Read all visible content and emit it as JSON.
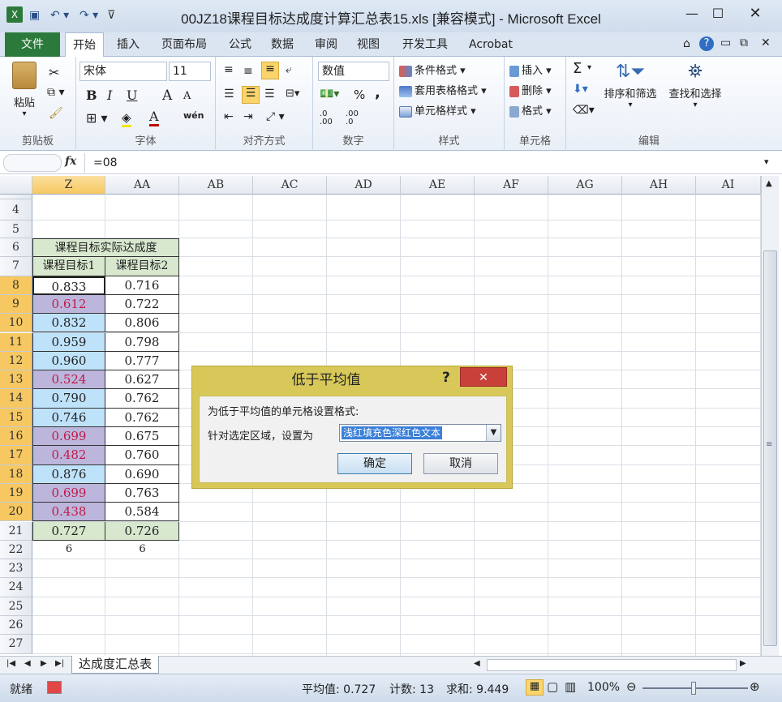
{
  "window": {
    "title": "00JZ18课程目标达成度计算汇总表15.xls  [兼容模式] - Microsoft Excel"
  },
  "tabs": [
    "文件",
    "开始",
    "插入",
    "页面布局",
    "公式",
    "数据",
    "审阅",
    "视图",
    "开发工具",
    "Acrobat"
  ],
  "ribbon": {
    "clipboard": {
      "paste": "粘贴",
      "label": "剪贴板"
    },
    "font": {
      "name": "宋体",
      "size": "11",
      "label": "字体",
      "bold": "B",
      "italic": "I",
      "underline": "U",
      "grow": "A",
      "shrink": "A",
      "fontcolor": "A",
      "wen": "wén"
    },
    "alignment": {
      "label": "对齐方式"
    },
    "number": {
      "format": "数值",
      "label": "数字",
      "percent": "%",
      "comma": ",",
      "inc": ".0 .00",
      "dec": ".00 .0"
    },
    "styles": {
      "cond": "条件格式",
      "table": "套用表格格式",
      "cell": "单元格样式",
      "label": "样式"
    },
    "cells": {
      "insert": "插入",
      "delete": "删除",
      "format": "格式",
      "label": "单元格"
    },
    "editing": {
      "sigma": "Σ",
      "sort": "排序和筛选",
      "find": "查找和选择",
      "label": "编辑"
    }
  },
  "formula": {
    "fx": "fx",
    "value": "=08"
  },
  "columns": [
    "Z",
    "AA",
    "AB",
    "AC",
    "AD",
    "AE",
    "AF",
    "AG",
    "AH",
    "AI"
  ],
  "rows": [
    "4",
    "5",
    "6",
    "7",
    "8",
    "9",
    "10",
    "11",
    "12",
    "13",
    "14",
    "15",
    "16",
    "17",
    "18",
    "19",
    "20",
    "21",
    "22",
    "23",
    "24",
    "25",
    "26",
    "27"
  ],
  "table": {
    "title": "课程目标实际达成度",
    "headers": [
      "课程目标1",
      "课程目标2"
    ],
    "col1": [
      "0.833",
      "0.612",
      "0.832",
      "0.959",
      "0.960",
      "0.524",
      "0.790",
      "0.746",
      "0.699",
      "0.482",
      "0.876",
      "0.699",
      "0.438"
    ],
    "col1_style": [
      "plain",
      "purple",
      "blue",
      "blue",
      "blue",
      "purple",
      "blue",
      "blue",
      "purple",
      "purple",
      "blue",
      "purple",
      "purple"
    ],
    "col2": [
      "0.716",
      "0.722",
      "0.806",
      "0.798",
      "0.777",
      "0.627",
      "0.762",
      "0.762",
      "0.675",
      "0.760",
      "0.690",
      "0.763",
      "0.584"
    ],
    "avg": [
      "0.727",
      "0.726"
    ],
    "count": [
      "6",
      "6"
    ]
  },
  "dialog": {
    "title": "低于平均值",
    "help": "?",
    "close": "✕",
    "desc": "为低于平均值的单元格设置格式:",
    "label": "针对选定区域，设置为",
    "select_value": "浅红填充色深红色文本",
    "ok": "确定",
    "cancel": "取消"
  },
  "sheet": {
    "name": "达成度汇总表"
  },
  "status": {
    "ready": "就绪",
    "average": "平均值: 0.727",
    "count": "计数: 13",
    "sum": "求和: 9.449",
    "zoom": "100%"
  },
  "colors": {
    "accent": "#2b7a3b",
    "dialog": "#d8c85a",
    "close": "#c9403a",
    "selectedHeader": "#f7c861"
  }
}
